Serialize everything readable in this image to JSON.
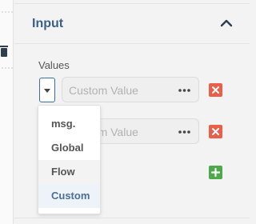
{
  "section": {
    "title": "Input",
    "values_label": "Values"
  },
  "rows": [
    {
      "placeholder": "Custom Value"
    },
    {
      "placeholder": "Custom Value"
    }
  ],
  "dropdown": {
    "options": [
      "msg.",
      "Global",
      "Flow",
      "Custom"
    ],
    "hovered": "Flow",
    "selected": "Custom"
  },
  "icons": {
    "collapse": "chevron-up-icon",
    "more": "ellipsis-icon",
    "delete": "close-icon",
    "add": "plus-icon",
    "trash": "trash-icon"
  },
  "colors": {
    "title": "#3b5f86",
    "delete": "#e8604c",
    "add": "#4fa84a",
    "select_border": "#3a6ea5"
  }
}
